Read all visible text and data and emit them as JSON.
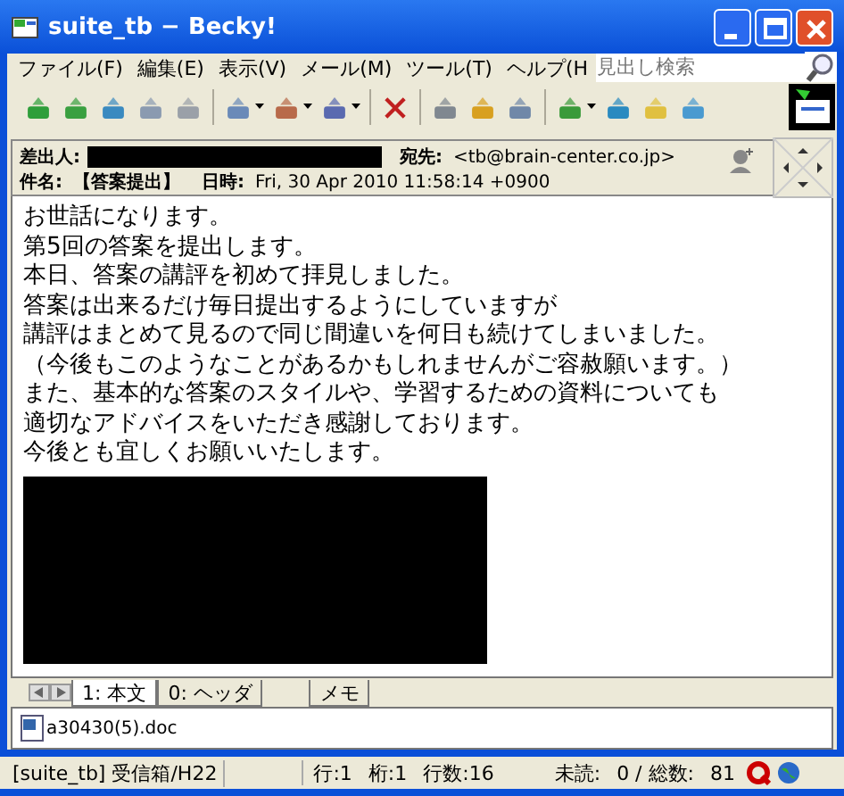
{
  "window": {
    "title": "suite_tb − Becky!"
  },
  "menu": [
    {
      "label": "ファイル(F)"
    },
    {
      "label": "編集(E)"
    },
    {
      "label": "表示(V)"
    },
    {
      "label": "メール(M)"
    },
    {
      "label": "ツール(T)"
    },
    {
      "label": "ヘルプ(H"
    }
  ],
  "search": {
    "placeholder": "見出し検索"
  },
  "header": {
    "from_label": "差出人:",
    "to_label": "宛先:",
    "to": "<tb@brain-center.co.jp>",
    "subject_label": "件名:",
    "subject": "【答案提出】",
    "date_label": "日時:",
    "date": "Fri, 30 Apr 2010 11:58:14 +0900"
  },
  "body": [
    "お世話になります。",
    "第5回の答案を提出します。",
    "本日、答案の講評を初めて拝見しました。",
    "答案は出来るだけ毎日提出するようにしていますが",
    "講評はまとめて見るので同じ間違いを何日も続けてしまいました。",
    "（今後もこのようなことがあるかもしれませんがご容赦願います。）",
    "また、基本的な答案のスタイルや、学習するための資料についても",
    "適切なアドバイスをいただき感謝しております。",
    "今後とも宜しくお願いいたします。"
  ],
  "tabs": [
    {
      "label": "1: 本文",
      "selected": true
    },
    {
      "label": "0: ヘッダ",
      "selected": false
    },
    {
      "label": "メモ",
      "selected": false
    }
  ],
  "attachment": {
    "name": "a30430(5).doc"
  },
  "status_bar": {
    "folder": "[suite_tb] 受信箱/H22",
    "line": "行:1",
    "column": "桁:1",
    "lines": "行数:16",
    "unread_label": "未読:",
    "unread_total": "0 / 総数:",
    "total": "81"
  }
}
